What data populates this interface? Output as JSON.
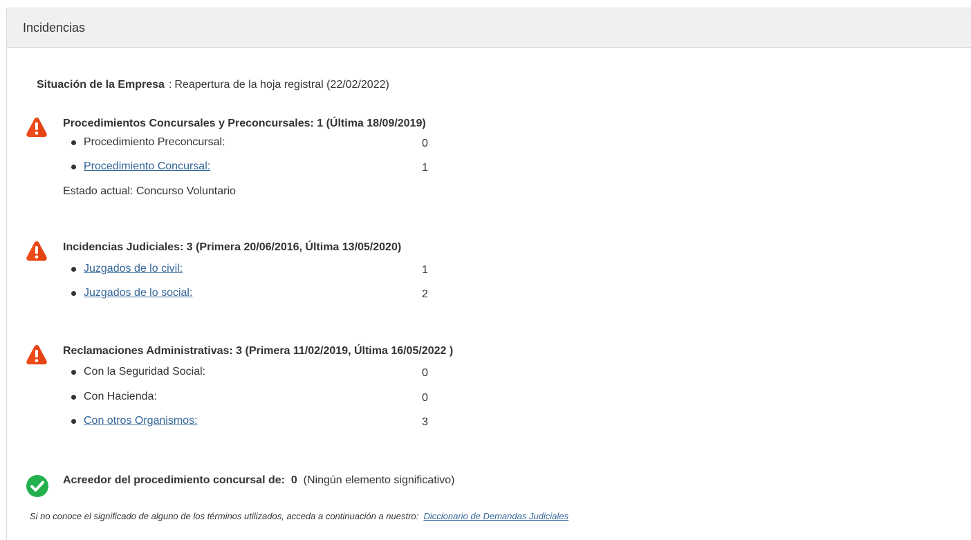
{
  "panel": {
    "title": "Incidencias"
  },
  "situacion": {
    "label": "Situación de la Empresa",
    "separator": ":",
    "value": "Reapertura de la hoja registral (22/02/2022)"
  },
  "concursales": {
    "title": "Procedimientos Concursales y Preconcursales: 1 (Última 18/09/2019)",
    "items": [
      {
        "label": "Procedimiento Preconcursal:",
        "value": "0"
      },
      {
        "label": "Procedimiento Concursal:",
        "value": "1"
      }
    ],
    "estado": "Estado actual: Concurso Voluntario"
  },
  "judiciales": {
    "title": "Incidencias Judiciales: 3 (Primera 20/06/2016, Última 13/05/2020)",
    "items": [
      {
        "label": "Juzgados de lo civil:",
        "value": "1"
      },
      {
        "label": "Juzgados de lo social:",
        "value": "2"
      }
    ]
  },
  "administrativas": {
    "title": "Reclamaciones Administrativas: 3 (Primera 11/02/2019, Última 16/05/2022 )",
    "items": [
      {
        "label": "Con la Seguridad Social:",
        "value": "0"
      },
      {
        "label": "Con Hacienda:",
        "value": "0"
      },
      {
        "label": "Con otros Organismos:",
        "value": "3"
      }
    ]
  },
  "acreedor": {
    "label": "Acreedor del procedimiento concursal de:",
    "count": "0",
    "note": "(Ningún elemento significativo)"
  },
  "footer": {
    "text": "Si no conoce el significado de alguno de los términos utilizados, acceda a continuación a nuestro:",
    "link": "Diccionario de Demandas Judiciales"
  },
  "icons": {
    "warning": "warning-triangle-icon",
    "ok": "check-circle-icon",
    "bullet": "bullet-dot"
  },
  "colors": {
    "warning": "#ee4b1a",
    "ok": "#22b14c",
    "link": "#336699"
  }
}
